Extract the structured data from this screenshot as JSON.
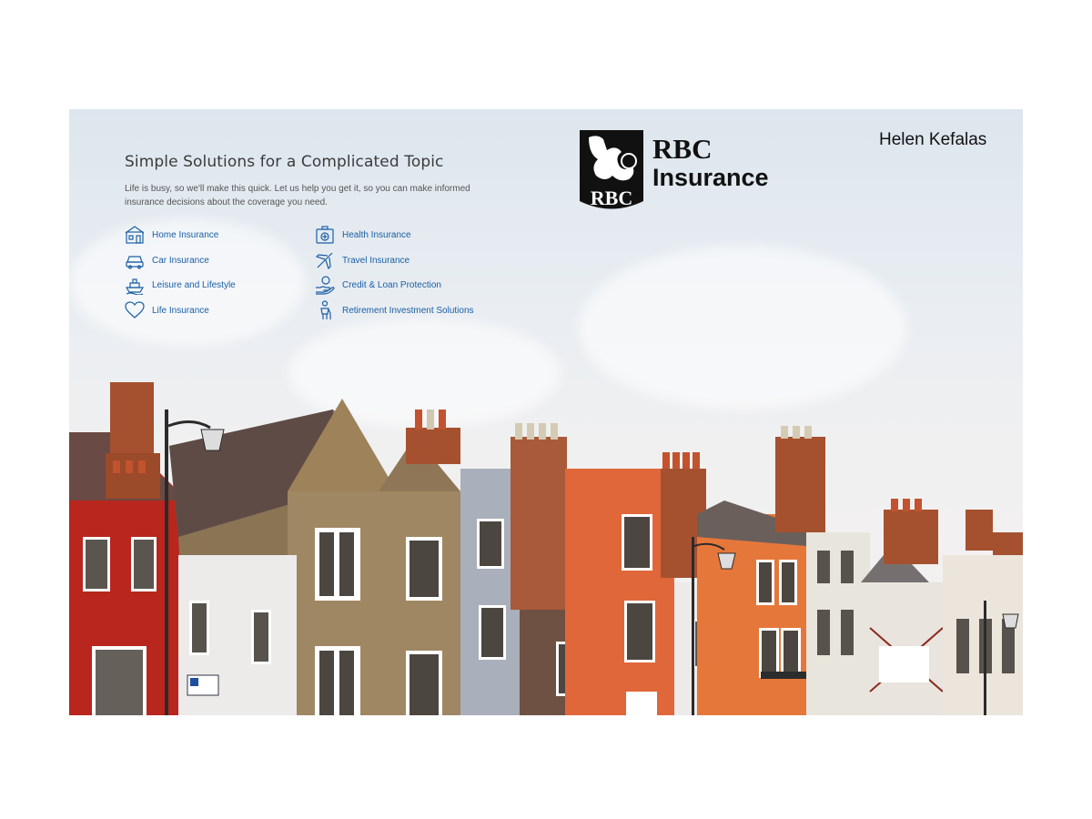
{
  "header": {
    "user_name": "Helen Kefalas",
    "logo": {
      "shield_text": "RBC",
      "wordmark_line1": "RBC",
      "wordmark_line2": "Insurance"
    }
  },
  "intro": {
    "headline": "Simple Solutions for a Complicated Topic",
    "body": "Life is busy, so we'll make this quick. Let us help you get it, so you can make informed insurance decisions about the coverage you need."
  },
  "links": [
    {
      "label": "Home Insurance",
      "icon": "house-icon"
    },
    {
      "label": "Car Insurance",
      "icon": "car-icon"
    },
    {
      "label": "Leisure and Lifestyle",
      "icon": "boat-icon"
    },
    {
      "label": "Life Insurance",
      "icon": "heart-icon"
    },
    {
      "label": "Health Insurance",
      "icon": "medical-kit-icon"
    },
    {
      "label": "Travel Insurance",
      "icon": "airplane-icon"
    },
    {
      "label": "Credit & Loan Protection",
      "icon": "hand-money-icon"
    },
    {
      "label": "Retirement Investment Solutions",
      "icon": "person-icon"
    }
  ],
  "colors": {
    "link": "#1a5fa6",
    "brick": "#a5512f",
    "orange": "#e0673a",
    "red": "#b8261d"
  }
}
